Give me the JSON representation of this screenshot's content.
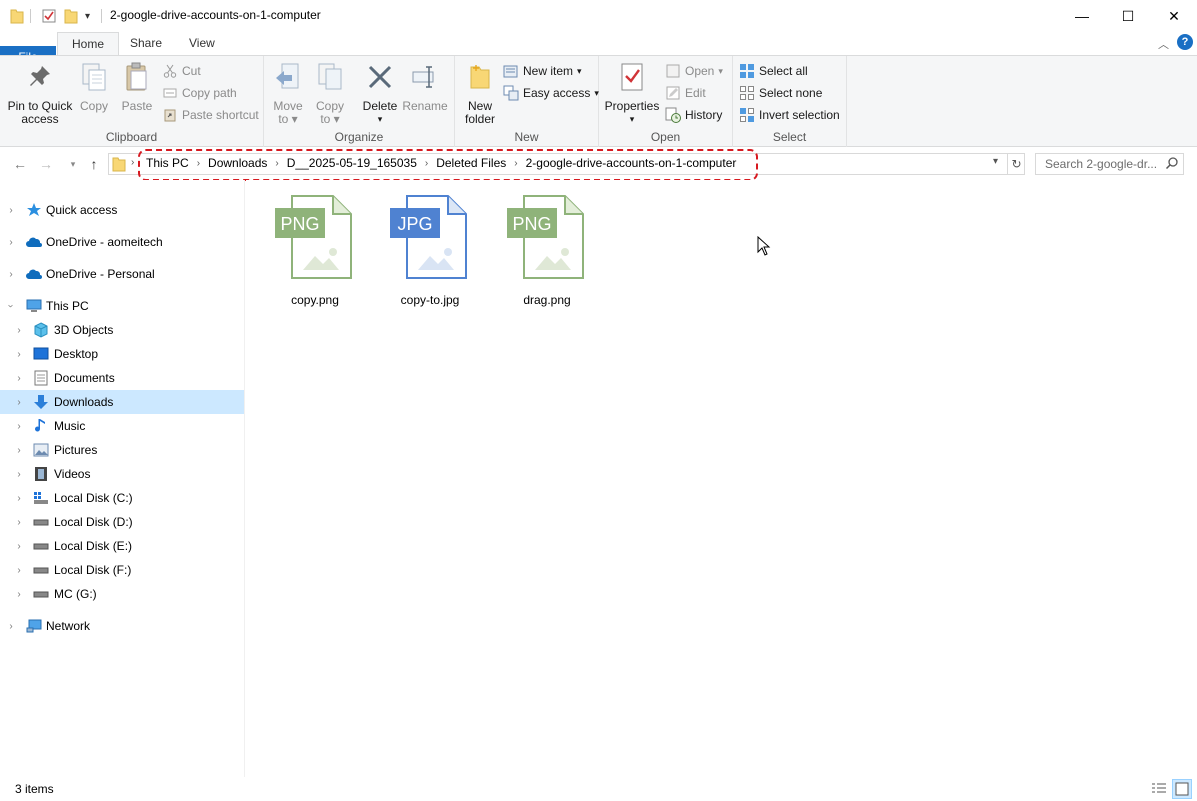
{
  "window": {
    "title": "2-google-drive-accounts-on-1-computer",
    "minimize_glyph": "—",
    "maximize_glyph": "☐",
    "close_glyph": "✕"
  },
  "tabs": [
    {
      "label": "File"
    },
    {
      "label": "Home"
    },
    {
      "label": "Share"
    },
    {
      "label": "View"
    }
  ],
  "ribbon": {
    "clipboard": {
      "label": "Clipboard",
      "pin": "Pin to Quick access",
      "pin_line1": "Pin to Quick",
      "pin_line2": "access",
      "copy": "Copy",
      "paste": "Paste",
      "cut": "Cut",
      "copy_path": "Copy path",
      "paste_shortcut": "Paste shortcut"
    },
    "organize": {
      "label": "Organize",
      "move_line1": "Move",
      "move_line2": "to",
      "copy_line1": "Copy",
      "copy_line2": "to",
      "delete": "Delete",
      "rename": "Rename"
    },
    "new": {
      "label": "New",
      "new_folder_line1": "New",
      "new_folder_line2": "folder",
      "new_item": "New item",
      "easy_access": "Easy access"
    },
    "open": {
      "label": "Open",
      "properties": "Properties",
      "open": "Open",
      "edit": "Edit",
      "history": "History"
    },
    "select": {
      "label": "Select",
      "select_all": "Select all",
      "select_none": "Select none",
      "invert_selection": "Invert selection"
    }
  },
  "address": {
    "crumbs": [
      "This PC",
      "Downloads",
      "D__2025-05-19_165035",
      "Deleted Files",
      "2-google-drive-accounts-on-1-computer"
    ],
    "search_placeholder": "Search 2-google-dr..."
  },
  "sidebar": {
    "quick_access": "Quick access",
    "onedrive_aomei": "OneDrive - aomeitech",
    "onedrive_personal": "OneDrive - Personal",
    "this_pc": "This PC",
    "objects_3d": "3D Objects",
    "desktop": "Desktop",
    "documents": "Documents",
    "downloads": "Downloads",
    "music": "Music",
    "pictures": "Pictures",
    "videos": "Videos",
    "disk_c": "Local Disk (C:)",
    "disk_d": "Local Disk (D:)",
    "disk_e": "Local Disk (E:)",
    "disk_f": "Local Disk (F:)",
    "disk_g": "MC (G:)",
    "network": "Network"
  },
  "files": [
    {
      "name": "copy.png",
      "badge": "PNG",
      "color": "#8fb37a"
    },
    {
      "name": "copy-to.jpg",
      "badge": "JPG",
      "color": "#4f82d1"
    },
    {
      "name": "drag.png",
      "badge": "PNG",
      "color": "#8fb37a"
    }
  ],
  "status": {
    "item_count": "3 items"
  },
  "colors": {
    "accent": "#1a6fc4",
    "selection": "#cce8ff",
    "highlight": "#d71920"
  }
}
